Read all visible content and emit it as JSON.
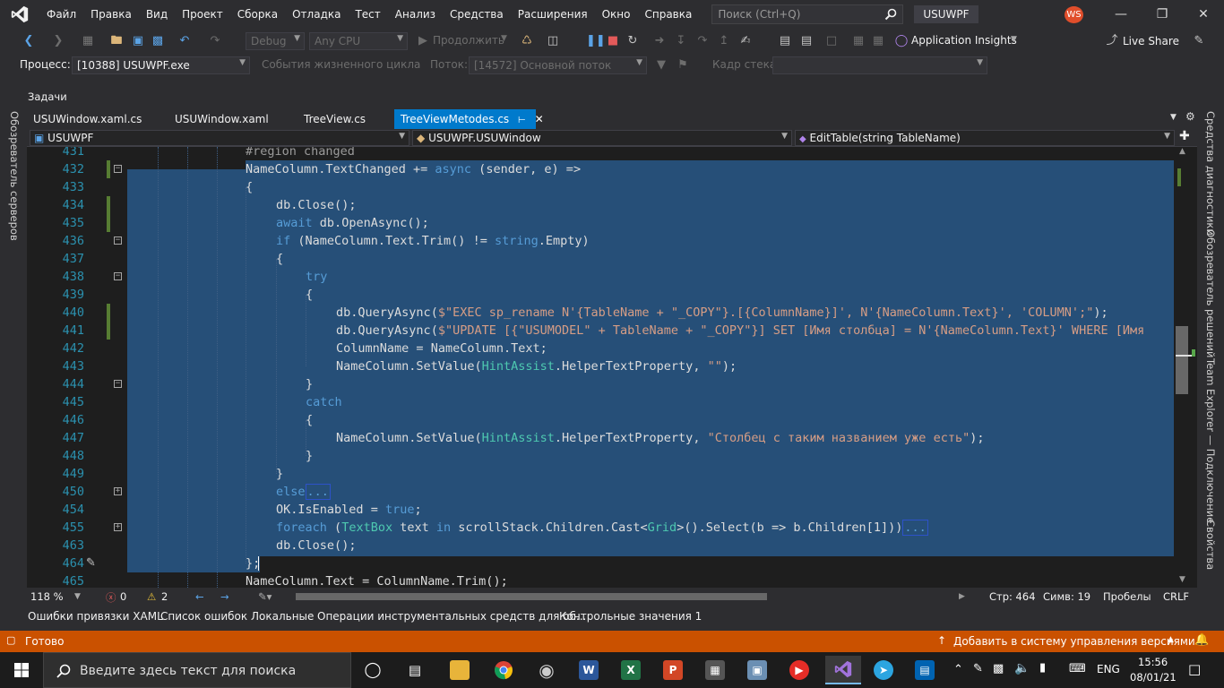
{
  "menubar": {
    "items": [
      "Файл",
      "Правка",
      "Вид",
      "Проект",
      "Сборка",
      "Отладка",
      "Тест",
      "Анализ",
      "Средства",
      "Расширения",
      "Окно",
      "Справка"
    ],
    "search_placeholder": "Поиск (Ctrl+Q)",
    "solution_name": "USUWPF",
    "user_initials": "WS"
  },
  "toolbar1": {
    "config": "Debug",
    "platform": "Any CPU",
    "continue_label": "Продолжить",
    "app_insights": "Application Insights",
    "live_share": "Live Share"
  },
  "toolbar2": {
    "process_label": "Процесс:",
    "process_value": "[10388] USUWPF.exe",
    "lifecycle_label": "События жизненного цикла",
    "thread_label": "Поток:",
    "thread_value": "[14572] Основной поток",
    "frame_label": "Кадр стека:"
  },
  "tasks_label": "Задачи",
  "left_sidebar": "Обозреватель серверов",
  "right_sidebar": [
    "Средства диагностики",
    "Обозреватель решений",
    "Team Explorer — Подключение",
    "Свойства"
  ],
  "tabs": [
    {
      "label": "USUWindow.xaml.cs"
    },
    {
      "label": "USUWindow.xaml"
    },
    {
      "label": "TreeView.cs"
    },
    {
      "label": "TreeViewMetodes.cs"
    }
  ],
  "navbar": {
    "project": "USUWPF",
    "class": "USUWPF.USUWindow",
    "member": "EditTable(string TableName)"
  },
  "code_lines": [
    {
      "n": "431",
      "text": "#region changed"
    },
    {
      "n": "432",
      "text": "NameColumn.TextChanged += async (sender, e) =>"
    },
    {
      "n": "433",
      "text": "{"
    },
    {
      "n": "434",
      "text": "db.Close();"
    },
    {
      "n": "435",
      "text": "await db.OpenAsync();"
    },
    {
      "n": "436",
      "text": "if (NameColumn.Text.Trim() != string.Empty)"
    },
    {
      "n": "437",
      "text": "{"
    },
    {
      "n": "438",
      "text": "try"
    },
    {
      "n": "439",
      "text": "{"
    },
    {
      "n": "440",
      "text": "db.QueryAsync($\"EXEC sp_rename N'{TableName + \"_COPY\"}.[{ColumnName}]', N'{NameColumn.Text}', 'COLUMN';\");"
    },
    {
      "n": "441",
      "text": "db.QueryAsync($\"UPDATE [{\"USUMODEL\" + TableName + \"_COPY\"}] SET [Имя столбца] = N'{NameColumn.Text}' WHERE [Имя"
    },
    {
      "n": "442",
      "text": "ColumnName = NameColumn.Text;"
    },
    {
      "n": "443",
      "text": "NameColumn.SetValue(HintAssist.HelperTextProperty, \"\");"
    },
    {
      "n": "444",
      "text": "}"
    },
    {
      "n": "445",
      "text": "catch"
    },
    {
      "n": "446",
      "text": "{"
    },
    {
      "n": "447",
      "text": "NameColumn.SetValue(HintAssist.HelperTextProperty, \"Столбец с таким названием уже есть\");"
    },
    {
      "n": "448",
      "text": "}"
    },
    {
      "n": "449",
      "text": "}"
    },
    {
      "n": "450",
      "text": "else..."
    },
    {
      "n": "454",
      "text": "OK.IsEnabled = true;"
    },
    {
      "n": "455",
      "text": "foreach (TextBox text in scrollStack.Children.Cast<Grid>().Select(b => b.Children[1]))..."
    },
    {
      "n": "463",
      "text": "db.Close();"
    },
    {
      "n": "464",
      "text": "};"
    },
    {
      "n": "465",
      "text": "NameColumn.Text = ColumnName.Trim();"
    }
  ],
  "editor_status": {
    "zoom": "118 %",
    "errors": "0",
    "warnings": "2",
    "line": "Стр: 464",
    "col": "Симв: 19",
    "spaces": "Пробелы",
    "eol": "CRLF"
  },
  "bottom_tabs": [
    "Ошибки привязки XAML",
    "Список ошибок",
    "Локальные",
    "Операции инструментальных средств для об...",
    "Контрольные значения 1"
  ],
  "statusbar": {
    "ready": "Готово",
    "vcs": "Добавить в систему управления версиями"
  },
  "taskbar": {
    "search_placeholder": "Введите здесь текст для поиска",
    "lang": "ENG",
    "time": "15:56",
    "date": "08/01/21"
  },
  "colors": {
    "accent": "#007acc",
    "statusbar": "#ca5100",
    "selection": "#264f78"
  }
}
